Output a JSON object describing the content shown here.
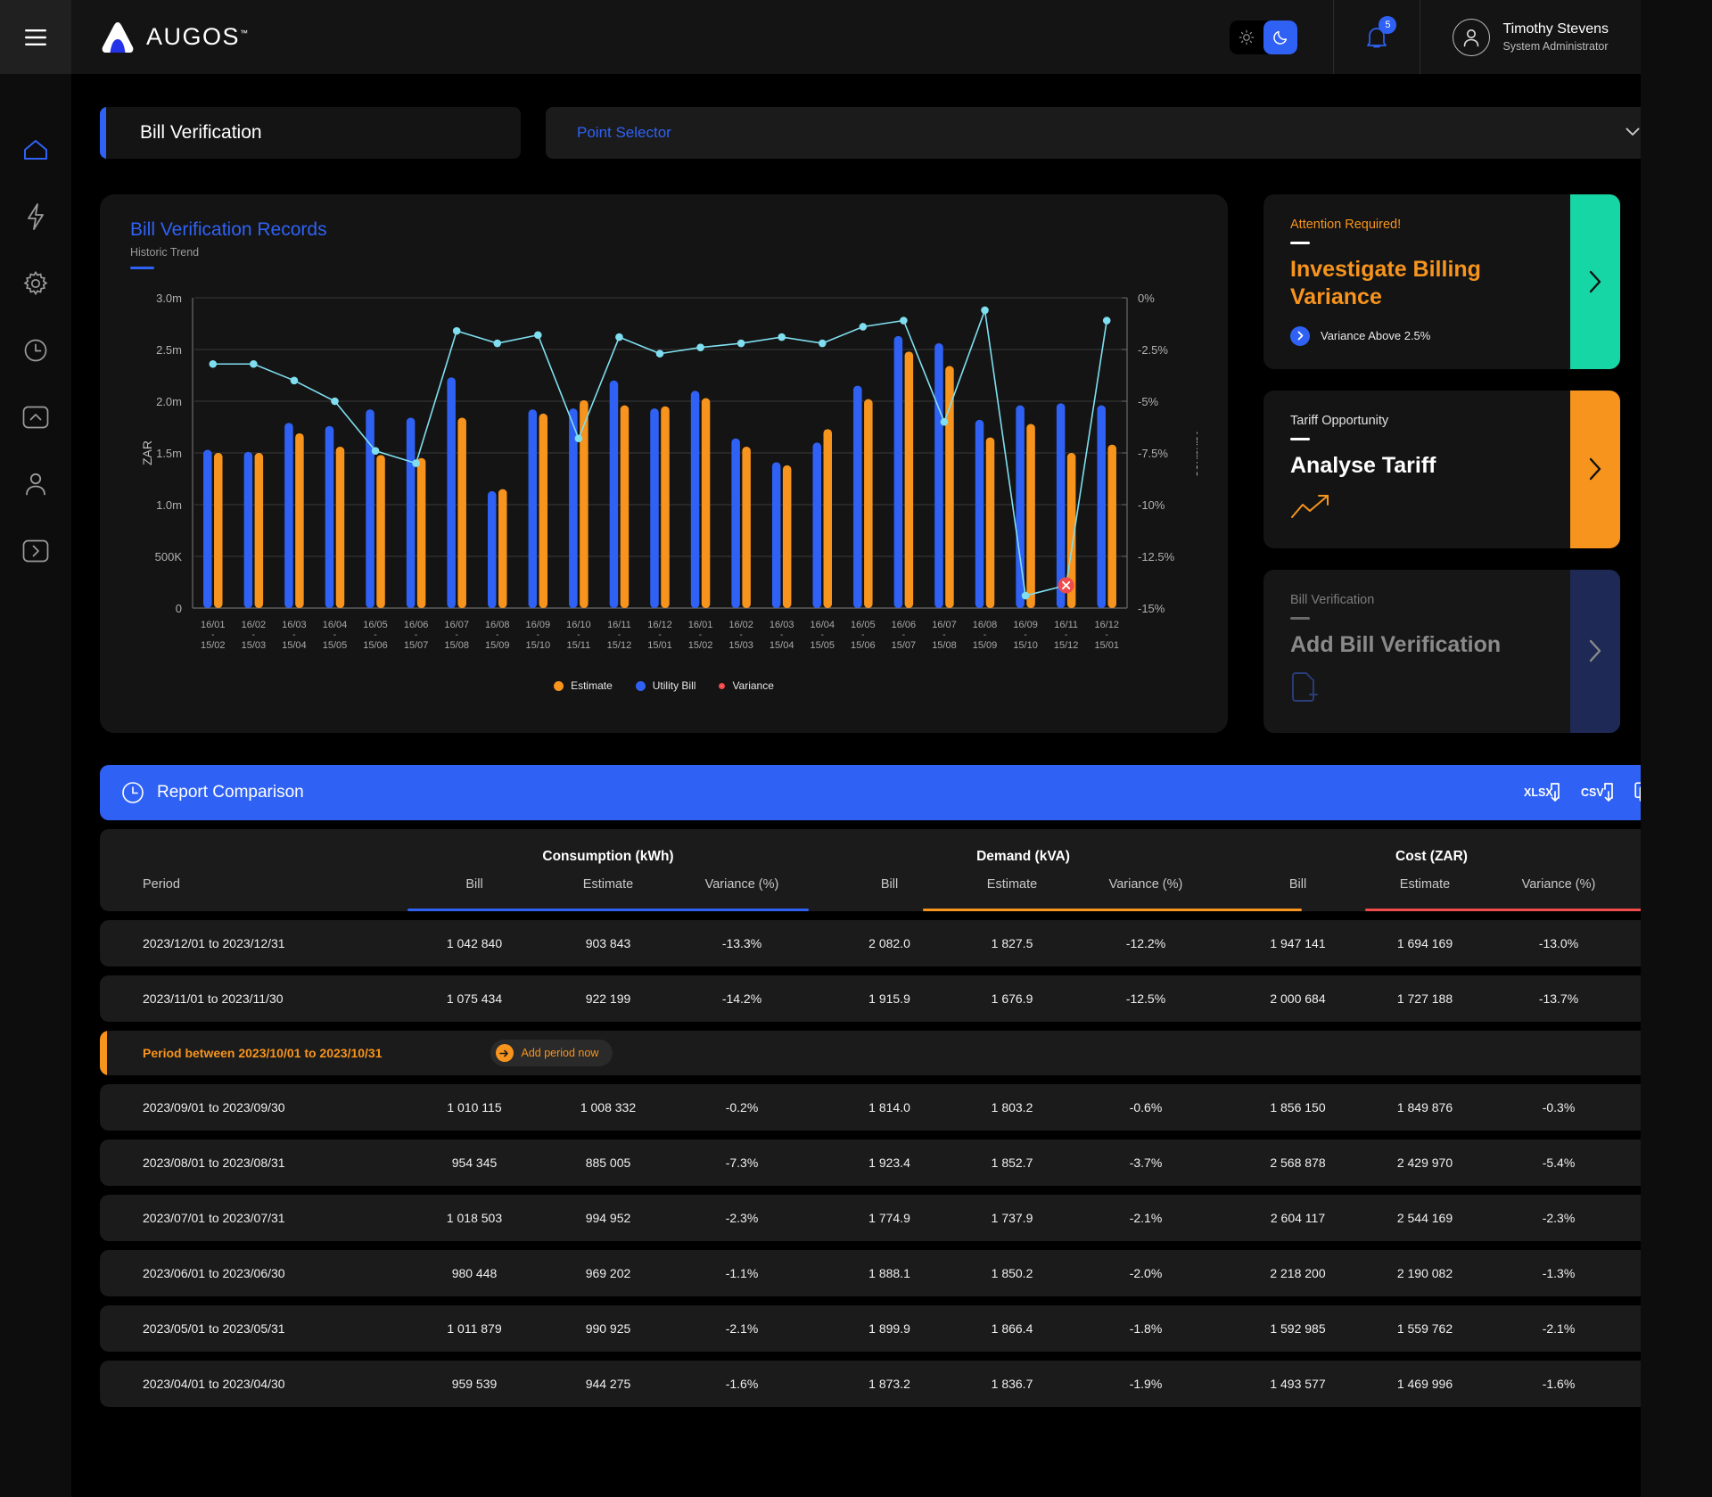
{
  "brand": {
    "name": "AUGOS",
    "tm": "™"
  },
  "topbar": {
    "theme": {
      "light_icon": "sun-icon",
      "dark_icon": "moon-icon",
      "active": "dark"
    },
    "notifications_count": "5",
    "user_name": "Timothy Stevens",
    "user_role": "System Administrator"
  },
  "sidebar": {
    "items": [
      {
        "icon": "home-icon",
        "active": true
      },
      {
        "icon": "lightning-icon",
        "active": false
      },
      {
        "icon": "gear-icon",
        "active": false
      },
      {
        "icon": "clock-icon",
        "active": false
      },
      {
        "icon": "chevron-up-box-icon",
        "active": false
      },
      {
        "icon": "person-icon",
        "active": false
      },
      {
        "icon": "chevron-right-box-icon",
        "active": false
      }
    ]
  },
  "header": {
    "page_title": "Bill Verification",
    "point_selector_label": "Point Selector"
  },
  "chart_card": {
    "title": "Bill Verification Records",
    "subtitle": "Historic Trend"
  },
  "chart_data": {
    "type": "bar",
    "title": "Bill Verification Records",
    "subtitle": "Historic Trend",
    "ylabel": "ZAR",
    "y2label": "Variance",
    "ylim": [
      0,
      3000000
    ],
    "ytick_labels": [
      "0",
      "500K",
      "1.0m",
      "1.5m",
      "2.0m",
      "2.5m",
      "3.0m"
    ],
    "ytick_values": [
      0,
      500000,
      1000000,
      1500000,
      2000000,
      2500000,
      3000000
    ],
    "y2lim": [
      -15,
      0
    ],
    "y2tick_labels": [
      "0%",
      "-2.5%",
      "-5%",
      "-7.5%",
      "-10%",
      "-12.5%",
      "-15%"
    ],
    "y2tick_values": [
      0,
      -2.5,
      -5,
      -7.5,
      -10,
      -12.5,
      -15
    ],
    "grid": true,
    "legend": [
      "Estimate",
      "Utility Bill",
      "Variance"
    ],
    "legend_position": "bottom",
    "colors": {
      "estimate": "#f7941d",
      "utility_bill": "#2f62f4",
      "variance": "#7fdff0",
      "variance_marker_alert": "#f04a4a"
    },
    "categories": [
      "16/01 - 15/02",
      "16/02 - 15/03",
      "16/03 - 15/04",
      "16/04 - 15/05",
      "16/05 - 15/06",
      "16/06 - 15/07",
      "16/07 - 15/08",
      "16/08 - 15/09",
      "16/09 - 15/10",
      "16/10 - 15/11",
      "16/11 - 15/12",
      "16/12 - 15/01",
      "16/01 - 15/02",
      "16/02 - 15/03",
      "16/03 - 15/04",
      "16/04 - 15/05",
      "16/05 - 15/06",
      "16/06 - 15/07",
      "16/07 - 15/08",
      "16/08 - 15/09",
      "16/09 - 15/10",
      "16/11 - 15/12",
      "16/12 - 15/01"
    ],
    "series": [
      {
        "name": "Utility Bill",
        "color": "#2f62f4",
        "values": [
          1530000,
          1510000,
          1790000,
          1760000,
          1920000,
          1840000,
          2230000,
          1130000,
          1920000,
          1930000,
          2200000,
          1930000,
          2100000,
          1640000,
          1410000,
          1600000,
          2150000,
          2630000,
          2560000,
          1820000,
          1960000,
          1980000,
          1960000
        ]
      },
      {
        "name": "Estimate",
        "color": "#f7941d",
        "values": [
          1500000,
          1500000,
          1690000,
          1560000,
          1480000,
          1450000,
          1840000,
          1150000,
          1880000,
          2010000,
          1960000,
          1950000,
          2030000,
          1560000,
          1380000,
          1730000,
          2020000,
          2480000,
          2340000,
          1650000,
          1780000,
          1500000,
          1580000
        ]
      },
      {
        "name": "Variance",
        "color": "#7fdff0",
        "axis": "right",
        "values": [
          -3.2,
          -3.2,
          -4.0,
          -5.0,
          -7.4,
          -8.0,
          -1.6,
          -2.2,
          -1.8,
          -6.8,
          -1.9,
          -2.7,
          -2.4,
          -2.2,
          -1.9,
          -2.2,
          -1.4,
          -1.1,
          -6.0,
          -0.6,
          -14.4,
          -13.9,
          -1.1
        ]
      }
    ],
    "alert_point_index": 21
  },
  "promo_cards": [
    {
      "kicker": "Attention Required!",
      "title": "Investigate Billing Variance",
      "foot": "Variance Above 2.5%",
      "kicker_color": "#f7941d",
      "title_color": "#f7941d",
      "accent": "#17d6a5",
      "icon": "",
      "muted": false
    },
    {
      "kicker": "Tariff Opportunity",
      "title": "Analyse Tariff",
      "foot": "",
      "kicker_color": "#e3e3e3",
      "title_color": "#ffffff",
      "accent": "#f7941d",
      "icon": "trend-up-icon",
      "muted": false
    },
    {
      "kicker": "Bill Verification",
      "title": "Add Bill Verification",
      "foot": "",
      "kicker_color": "#7c7c7c",
      "title_color": "#8a8a8a",
      "accent": "#1e2a55",
      "icon": "add-document-icon",
      "muted": true
    }
  ],
  "report": {
    "title": "Report Comparison",
    "export_xlsx": "XLSX",
    "export_csv": "CSV",
    "copy_icon": "copy-icon",
    "collapse_icon": "chevron-down-icon"
  },
  "table": {
    "groups": [
      {
        "label": "Consumption (kWh)",
        "color": "#2f62f4"
      },
      {
        "label": "Demand (kVA)",
        "color": "#f7941d"
      },
      {
        "label": "Cost (ZAR)",
        "color": "#f04a4a"
      }
    ],
    "columns": [
      "Period",
      "Bill",
      "Estimate",
      "Variance (%)",
      "Bill",
      "Estimate",
      "Variance (%)",
      "Bill",
      "Estimate",
      "Variance (%)"
    ],
    "rows": [
      {
        "period": "2023/12/01 to 2023/12/31",
        "c_bill": "1 042 840",
        "c_est": "903 843",
        "c_var": "-13.3%",
        "d_bill": "2 082.0",
        "d_est": "1 827.5",
        "d_var": "-12.2%",
        "z_bill": "1 947 141",
        "z_est": "1 694 169",
        "z_var": "-13.0%",
        "status": "bad"
      },
      {
        "period": "2023/11/01 to 2023/11/30",
        "c_bill": "1 075 434",
        "c_est": "922 199",
        "c_var": "-14.2%",
        "d_bill": "1 915.9",
        "d_est": "1 676.9",
        "d_var": "-12.5%",
        "z_bill": "2 000 684",
        "z_est": "1 727 188",
        "z_var": "-13.7%",
        "status": "bad"
      },
      {
        "period": "2023/09/01 to 2023/09/30",
        "c_bill": "1 010 115",
        "c_est": "1 008 332",
        "c_var": "-0.2%",
        "d_bill": "1 814.0",
        "d_est": "1 803.2",
        "d_var": "-0.6%",
        "z_bill": "1 856 150",
        "z_est": "1 849 876",
        "z_var": "-0.3%",
        "status": "ok"
      },
      {
        "period": "2023/08/01 to 2023/08/31",
        "c_bill": "954 345",
        "c_est": "885 005",
        "c_var": "-7.3%",
        "d_bill": "1 923.4",
        "d_est": "1 852.7",
        "d_var": "-3.7%",
        "z_bill": "2 568 878",
        "z_est": "2 429 970",
        "z_var": "-5.4%",
        "status": "bad"
      },
      {
        "period": "2023/07/01 to 2023/07/31",
        "c_bill": "1 018 503",
        "c_est": "994 952",
        "c_var": "-2.3%",
        "d_bill": "1 774.9",
        "d_est": "1 737.9",
        "d_var": "-2.1%",
        "z_bill": "2 604 117",
        "z_est": "2 544 169",
        "z_var": "-2.3%",
        "status": "ok"
      },
      {
        "period": "2023/06/01 to 2023/06/30",
        "c_bill": "980 448",
        "c_est": "969 202",
        "c_var": "-1.1%",
        "d_bill": "1 888.1",
        "d_est": "1 850.2",
        "d_var": "-2.0%",
        "z_bill": "2 218 200",
        "z_est": "2 190 082",
        "z_var": "-1.3%",
        "status": "ok"
      },
      {
        "period": "2023/05/01 to 2023/05/31",
        "c_bill": "1 011 879",
        "c_est": "990 925",
        "c_var": "-2.1%",
        "d_bill": "1 899.9",
        "d_est": "1 866.4",
        "d_var": "-1.8%",
        "z_bill": "1 592 985",
        "z_est": "1 559 762",
        "z_var": "-2.1%",
        "status": "ok"
      },
      {
        "period": "2023/04/01 to 2023/04/30",
        "c_bill": "959 539",
        "c_est": "944 275",
        "c_var": "-1.6%",
        "d_bill": "1 873.2",
        "d_est": "1 836.7",
        "d_var": "-1.9%",
        "z_bill": "1 493 577",
        "z_est": "1 469 996",
        "z_var": "-1.6%",
        "status": "ok"
      }
    ],
    "missing_period_row": {
      "text": "Period between 2023/10/01 to 2023/10/31",
      "button": "Add period now",
      "insert_after_index": 1
    }
  }
}
